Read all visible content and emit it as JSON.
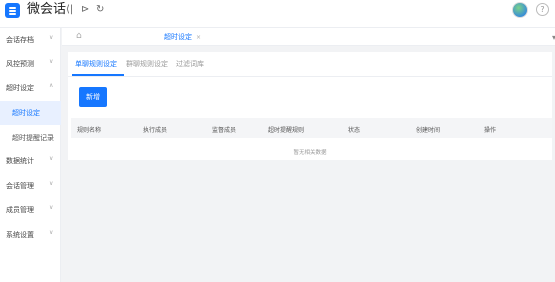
{
  "header": {
    "brand": "微会话",
    "collapse_icon": "collapse-menu-icon",
    "pin_icon": "pin-icon",
    "refresh_icon": "refresh-icon",
    "help_icon": "help-icon",
    "help_glyph": "?"
  },
  "sidebar": {
    "items": [
      {
        "label": "会话存档"
      },
      {
        "label": "风控预测"
      },
      {
        "label": "超时设定"
      },
      {
        "label": "超时设定"
      },
      {
        "label": "超时提醒记录"
      },
      {
        "label": "数据统计"
      },
      {
        "label": "会话管理"
      },
      {
        "label": "成员管理"
      },
      {
        "label": "系统设置"
      }
    ]
  },
  "tabs": {
    "active_label": "超时设定",
    "close_glyph": "×"
  },
  "content": {
    "subtabs": [
      "单聊规则设定",
      "群聊规则设定",
      "过滤词库"
    ],
    "add_button": "新增",
    "columns": [
      "规则名称",
      "执行成员",
      "监督成员",
      "超时提醒规则",
      "状态",
      "创建时间",
      "操作"
    ],
    "empty_text": "暂无相关数据"
  },
  "colors": {
    "accent": "#1677ff",
    "background": "#f2f3f5"
  }
}
